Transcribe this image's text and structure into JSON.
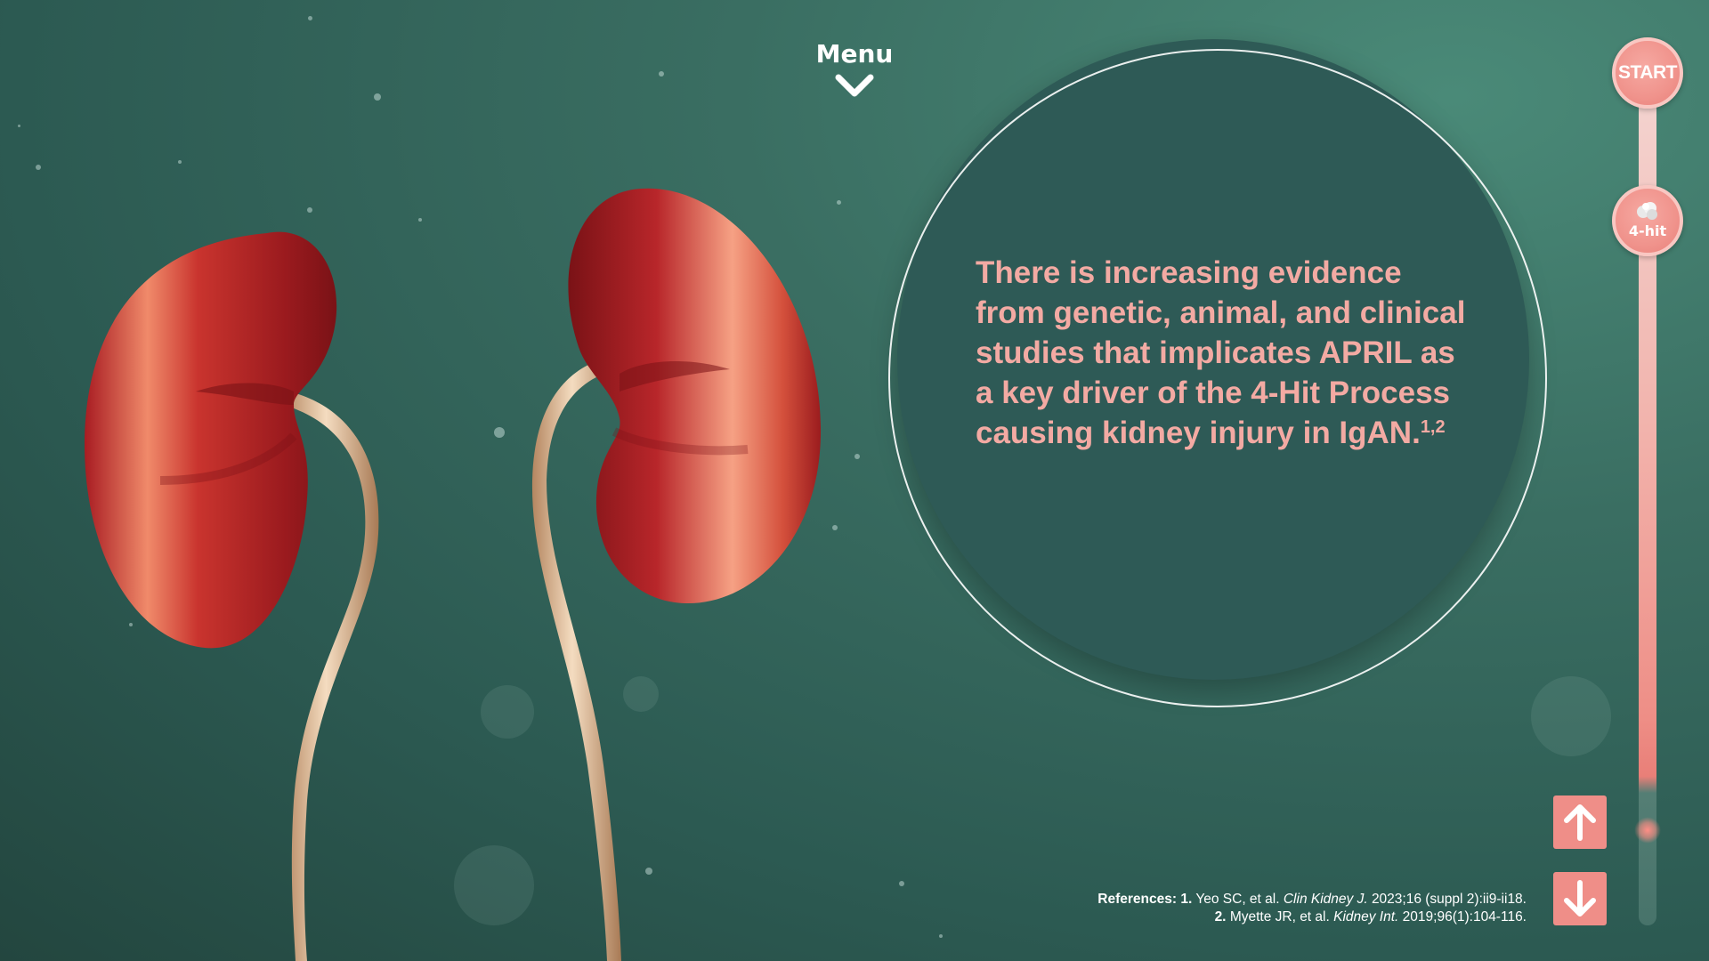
{
  "menu": {
    "label": "Menu"
  },
  "info": {
    "text": "There is increasing evidence from genetic, animal, and clinical studies that implicates APRIL as a key driver of the 4-Hit Process causing kidney injury in IgAN.",
    "superscript": "1,2"
  },
  "progress": {
    "start_label": "START",
    "hit_label": "4-hit",
    "progress_fraction": 0.9
  },
  "references": {
    "heading": "References:",
    "ref1": {
      "num": "1.",
      "authors": "Yeo SC, et al.",
      "journal": "Clin Kidney J.",
      "details": "2023;16 (suppl 2):ii9-ii18."
    },
    "ref2": {
      "num": "2.",
      "authors": "Myette JR, et al.",
      "journal": "Kidney Int.",
      "details": "2019;96(1):104-116."
    }
  },
  "colors": {
    "accent_pink": "#ef8e88",
    "text_pink": "#f3aaa3",
    "background_teal": "#2c5a52",
    "circle_fill": "#2e5a56"
  },
  "icons": {
    "menu": "chevron-down-icon",
    "up": "arrow-up-icon",
    "down": "arrow-down-icon",
    "hit_node": "cell-cluster-icon"
  }
}
